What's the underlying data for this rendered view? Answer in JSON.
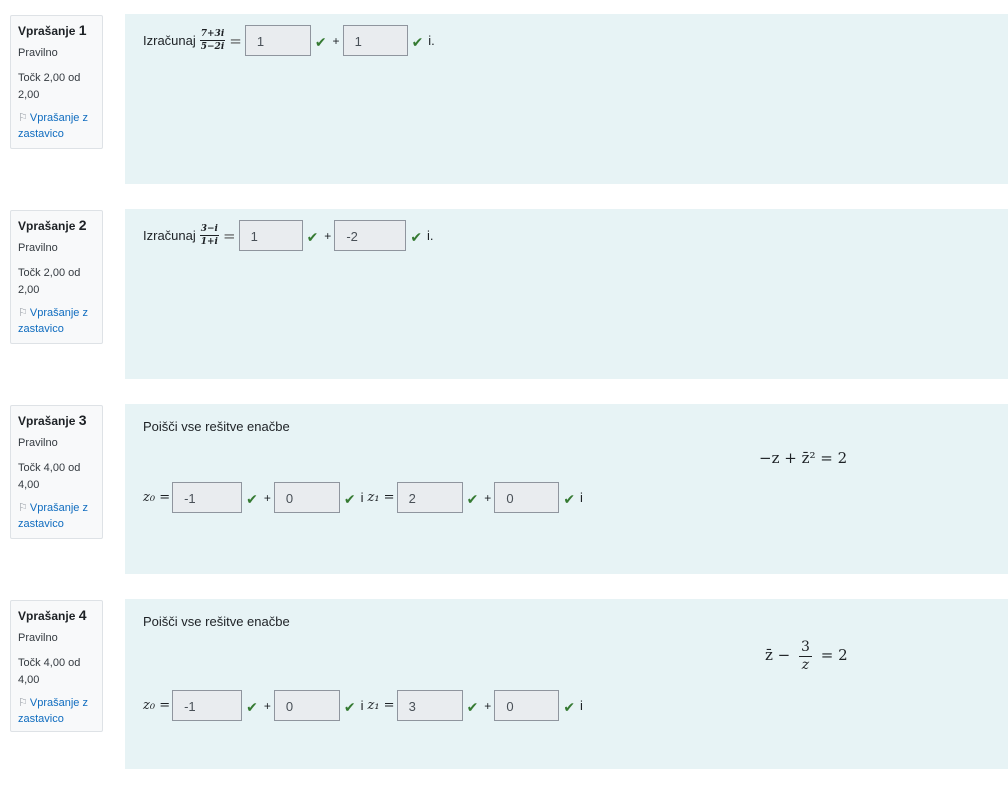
{
  "questions": [
    {
      "title_prefix": "Vprašanje",
      "number": "1",
      "state": "Pravilno",
      "grade": "Točk 2,00 od 2,00",
      "flag": "Vprašanje z zastavico",
      "prompt": "Izračunaj",
      "frac_num": "7+3i",
      "frac_den": "5−2i",
      "eq": "=",
      "re": "1",
      "im": "1",
      "tail": "i."
    },
    {
      "title_prefix": "Vprašanje",
      "number": "2",
      "state": "Pravilno",
      "grade": "Točk 2,00 od 2,00",
      "flag": "Vprašanje z zastavico",
      "prompt": "Izračunaj",
      "frac_num": "3−i",
      "frac_den": "1+i",
      "eq": "=",
      "re": "1",
      "im": "-2",
      "tail": "i."
    },
    {
      "title_prefix": "Vprašanje",
      "number": "3",
      "state": "Pravilno",
      "grade": "Točk 4,00 od 4,00",
      "flag": "Vprašanje z zastavico",
      "statement": "Poišči vse rešitve enačbe",
      "equation": "−z + z̄² = 2",
      "z0_label": "z₀ =",
      "z0_re": "-1",
      "z0_im": "0",
      "and": "i",
      "z1_label": "z₁ =",
      "z1_re": "2",
      "z1_im": "0",
      "tail": "i"
    },
    {
      "title_prefix": "Vprašanje",
      "number": "4",
      "state": "Pravilno",
      "grade": "Točk 4,00 od 4,00",
      "flag": "Vprašanje z zastavico",
      "statement": "Poišči vse rešitve enačbe",
      "eq_left": "z̄ −",
      "eq_num": "3",
      "eq_den": "z",
      "eq_right": "= 2",
      "z0_label": "z₀ =",
      "z0_re": "-1",
      "z0_im": "0",
      "and": "i",
      "z1_label": "z₁ =",
      "z1_re": "3",
      "z1_im": "0",
      "tail": "i"
    }
  ],
  "symbols": {
    "plus": "+",
    "tick": "✔",
    "flag_icon": "⚐"
  },
  "colors": {
    "correct": "#357a32",
    "link": "#0f6cbf",
    "content_bg": "#e7f3f5"
  }
}
